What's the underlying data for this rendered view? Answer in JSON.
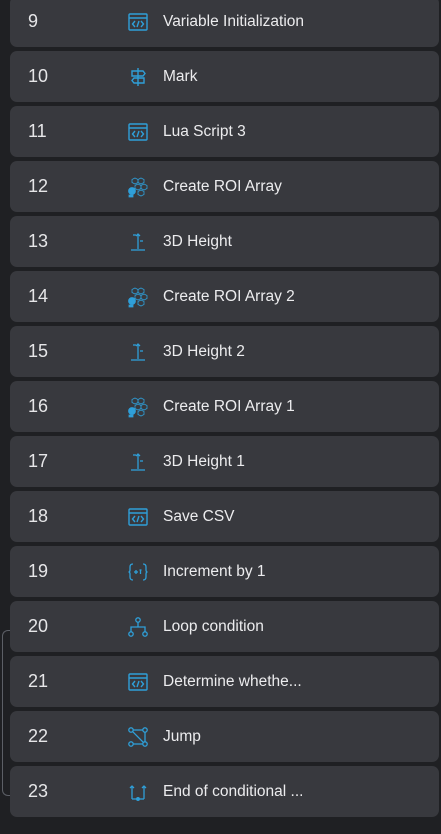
{
  "steps": [
    {
      "num": "9",
      "label": "Variable Initialization",
      "icon": "code-window-icon"
    },
    {
      "num": "10",
      "label": "Mark",
      "icon": "signpost-icon"
    },
    {
      "num": "11",
      "label": "Lua Script 3",
      "icon": "code-window-icon"
    },
    {
      "num": "12",
      "label": "Create ROI Array",
      "icon": "cube-array-icon"
    },
    {
      "num": "13",
      "label": "3D Height",
      "icon": "height-measure-icon"
    },
    {
      "num": "14",
      "label": "Create ROI Array 2",
      "icon": "cube-array-icon"
    },
    {
      "num": "15",
      "label": "3D Height 2",
      "icon": "height-measure-icon"
    },
    {
      "num": "16",
      "label": "Create ROI Array 1",
      "icon": "cube-array-icon"
    },
    {
      "num": "17",
      "label": "3D Height 1",
      "icon": "height-measure-icon"
    },
    {
      "num": "18",
      "label": "Save CSV",
      "icon": "code-window-icon"
    },
    {
      "num": "19",
      "label": "Increment by 1",
      "icon": "increment-braces-icon"
    },
    {
      "num": "20",
      "label": "Loop condition",
      "icon": "branch-icon"
    },
    {
      "num": "21",
      "label": "Determine whethe...",
      "icon": "code-window-icon"
    },
    {
      "num": "22",
      "label": "Jump",
      "icon": "jump-loop-icon"
    },
    {
      "num": "23",
      "label": "End of conditional ...",
      "icon": "end-conditional-icon"
    }
  ],
  "colors": {
    "background": "#1f2023",
    "row": "#38393e",
    "text": "#ececee",
    "icon_accent": "#2f9fd8"
  }
}
